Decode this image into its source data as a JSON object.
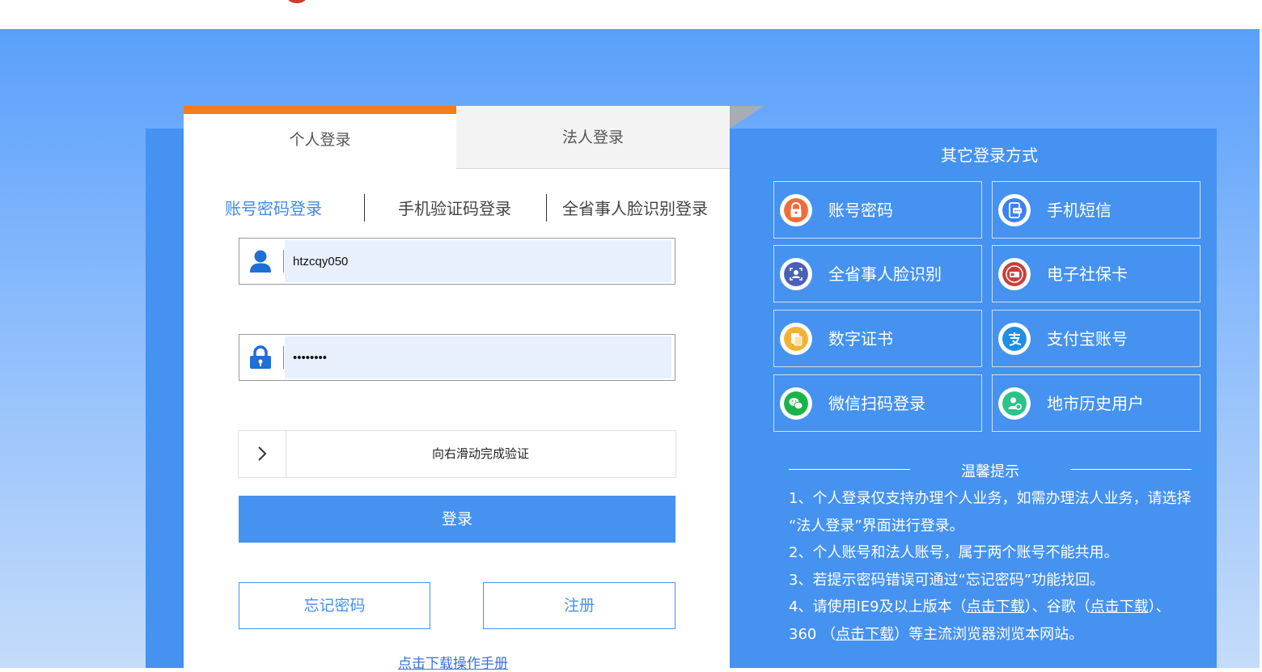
{
  "tabs": {
    "personal": "个人登录",
    "legal": "法人登录"
  },
  "subtabs": [
    "账号密码登录",
    "手机验证码登录",
    "全省事人脸识别登录"
  ],
  "login_form": {
    "username": "htzcqy050",
    "password": "••••••••",
    "slider_icon": "chevron-right-icon",
    "slider_text": "向右滑动完成验证",
    "login_button": "登录",
    "forgot_password": "忘记密码",
    "register": "注册",
    "manual_link": "点击下载操作手册"
  },
  "other_methods": {
    "title": "其它登录方式",
    "items": [
      {
        "label": "账号密码",
        "icon": "lock-icon",
        "color": "#f26b3a"
      },
      {
        "label": "手机短信",
        "icon": "sms-icon",
        "color": "#3b82f0"
      },
      {
        "label": "全省事人脸识别",
        "icon": "face-id-icon",
        "color": "#4a5fb8"
      },
      {
        "label": "电子社保卡",
        "icon": "social-security-icon",
        "color": "#c8403a"
      },
      {
        "label": "数字证书",
        "icon": "certificate-icon",
        "color": "#f2b233"
      },
      {
        "label": "支付宝账号",
        "icon": "alipay-icon",
        "color": "#1d8fe8"
      },
      {
        "label": "微信扫码登录",
        "icon": "wechat-icon",
        "color": "#19b34a"
      },
      {
        "label": "地市历史用户",
        "icon": "user-history-icon",
        "color": "#2cc28c"
      }
    ]
  },
  "tips": {
    "title": "温馨提示",
    "line1": "1、个人登录仅支持办理个人业务，如需办理法人业务，请选择",
    "line1b": "“法人登录”界面进行登录。",
    "line2": "2、个人账号和法人账号，属于两个账号不能共用。",
    "line3": "3、若提示密码错误可通过“忘记密码”功能找回。",
    "line4_pre": "4、请使用IE9及以上版本（",
    "line4_link1": "点击下载",
    "line4_mid": "）、谷歌（",
    "line4_link2": "点击下载",
    "line4_post": "）、",
    "line5_pre": "360 （",
    "line5_link": "点击下载",
    "line5_post": "）等主流浏览器浏览本网站。"
  }
}
